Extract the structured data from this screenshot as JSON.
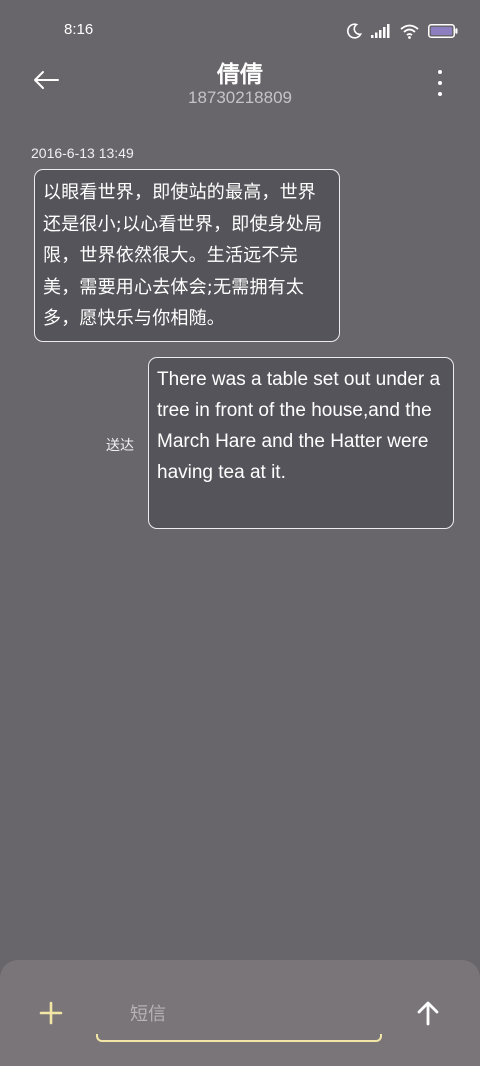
{
  "status_bar": {
    "time": "8:16",
    "icons": [
      "moon-icon",
      "signal-icon",
      "wifi-icon",
      "battery-icon"
    ]
  },
  "header": {
    "title": "倩倩",
    "subtitle": "18730218809",
    "back_icon": "arrow-left-icon",
    "more_icon": "more-vertical-icon"
  },
  "conversation": {
    "timestamp": "2016-6-13 13:49",
    "messages": [
      {
        "direction": "received",
        "text": "以眼看世界，即使站的最高，世界还是很小;以心看世界，即使身处局限，世界依然很大。生活远不完美，需要用心去体会;无需拥有太多，愿快乐与你相随。"
      },
      {
        "direction": "sent",
        "status": "送达",
        "text": "There was a table set out under a tree in front of the house,and the March Hare and the Hatter were having tea at it."
      }
    ]
  },
  "composer": {
    "placeholder": "短信",
    "value": "",
    "add_icon": "plus-icon",
    "send_icon": "arrow-up-icon",
    "accent_color": "#f1e6a6"
  },
  "colors": {
    "background": "#68666b",
    "bubble_background": "#55545a",
    "bubble_border": "#ecebee",
    "composer_background": "#7a7578"
  }
}
